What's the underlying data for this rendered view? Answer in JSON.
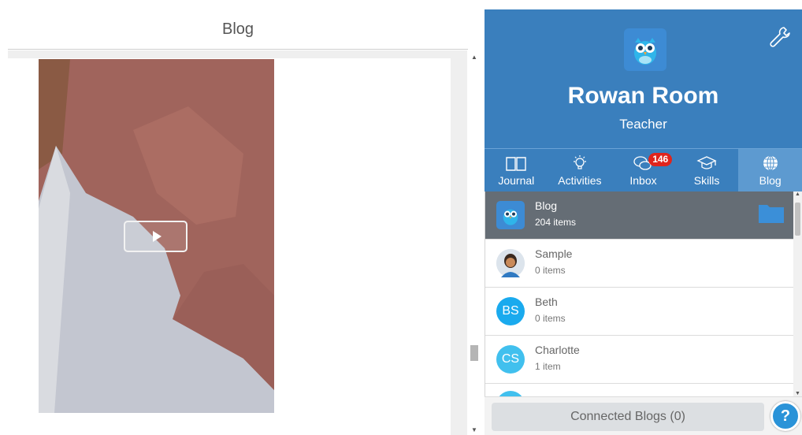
{
  "blog_pane": {
    "title": "Blog",
    "video": {
      "play_icon": "play-icon"
    }
  },
  "panel": {
    "room_name": "Rowan Room",
    "role": "Teacher",
    "settings_icon": "wrench-icon",
    "avatar_icon": "owl-icon"
  },
  "tabs": [
    {
      "label": "Journal",
      "icon": "book-icon"
    },
    {
      "label": "Activities",
      "icon": "lightbulb-icon"
    },
    {
      "label": "Inbox",
      "icon": "chat-bubbles-icon",
      "badge": "146"
    },
    {
      "label": "Skills",
      "icon": "graduation-cap-icon"
    },
    {
      "label": "Blog",
      "icon": "globe-icon"
    }
  ],
  "list": [
    {
      "name": "Blog",
      "count": "204 items",
      "avatar": "owl-icon",
      "selected": true
    },
    {
      "name": "Sample",
      "count": "0 items",
      "avatar": "person-avatar"
    },
    {
      "name": "Beth",
      "count": "0 items",
      "initials": "BS"
    },
    {
      "name": "Charlotte",
      "count": "1 item",
      "initials": "CS"
    }
  ],
  "footer": {
    "connected_label": "Connected Blogs (0)",
    "help_label": "?"
  },
  "colors": {
    "header_blue": "#3a7fbd",
    "active_tab": "#5d9ad0",
    "selected_row": "#656d75",
    "badge_red": "#e0241c",
    "initials_avatar": "#1aaaee"
  }
}
